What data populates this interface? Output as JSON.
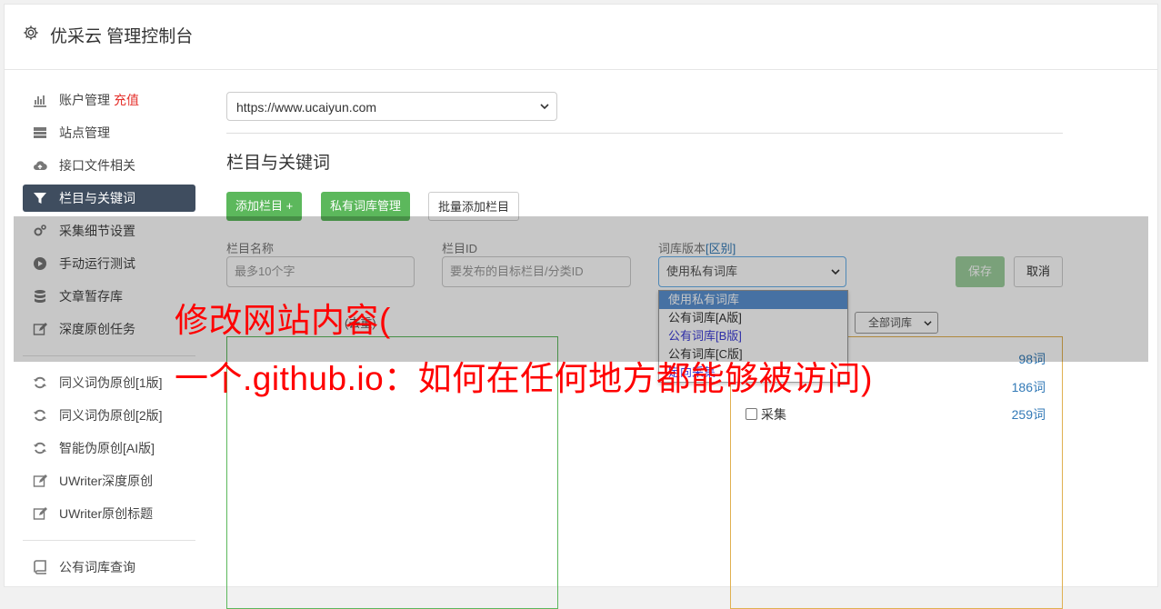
{
  "header": {
    "title": "优采云 管理控制台"
  },
  "sidebar": {
    "items": [
      {
        "label": "账户管理",
        "badge": "充值",
        "icon": "bar-chart-icon"
      },
      {
        "label": "站点管理",
        "icon": "server-icon"
      },
      {
        "label": "接口文件相关",
        "icon": "cloud-upload-icon"
      },
      {
        "label": "栏目与关键词",
        "icon": "filter-icon",
        "active": true
      },
      {
        "label": "采集细节设置",
        "icon": "cogs-icon"
      },
      {
        "label": "手动运行测试",
        "icon": "play-circle-icon"
      },
      {
        "label": "文章暂存库",
        "icon": "database-icon"
      },
      {
        "label": "深度原创任务",
        "icon": "edit-icon"
      }
    ],
    "items2": [
      {
        "label": "同义词伪原创[1版]",
        "icon": "refresh-icon"
      },
      {
        "label": "同义词伪原创[2版]",
        "icon": "refresh-icon"
      },
      {
        "label": "智能伪原创[AI版]",
        "icon": "refresh-icon"
      },
      {
        "label": "UWriter深度原创",
        "icon": "edit-icon"
      },
      {
        "label": "UWriter原创标题",
        "icon": "edit-icon"
      }
    ],
    "items3": [
      {
        "label": "公有词库查询",
        "icon": "book-icon"
      }
    ]
  },
  "main": {
    "site_select": "https://www.ucaiyun.com",
    "section_title": "栏目与关键词",
    "buttons": {
      "add_column": "添加栏目 +",
      "private_lib": "私有词库管理",
      "batch_add": "批量添加栏目"
    },
    "form": {
      "name_label": "栏目名称",
      "name_placeholder": "最多10个字",
      "id_label": "栏目ID",
      "id_placeholder": "要发布的目标栏目/分类ID",
      "version_label": "词库版本",
      "version_hint": "[区别]",
      "version_value": "使用私有词库",
      "save": "保存",
      "cancel": "取消"
    },
    "dropdown_options": [
      "使用私有词库",
      "公有词库[A版]",
      "公有词库[B版]",
      "公有词库[C版]",
      "定向采集"
    ],
    "list_label_suffix": "(去重)",
    "filter_select": "全部词库",
    "libraries": [
      {
        "label": "",
        "count": "98词"
      },
      {
        "label": "",
        "count": "186词"
      },
      {
        "label": "采集",
        "count": "259词"
      }
    ]
  },
  "watermark": {
    "line1": "修改网站内容(",
    "line2": "一个.github.io：如何在任何地方都能够被访问)"
  },
  "colors": {
    "active_nav": "#3f4d5f",
    "green": "#5cb85c",
    "link": "#337ab7",
    "watermark": "#ff0000"
  }
}
